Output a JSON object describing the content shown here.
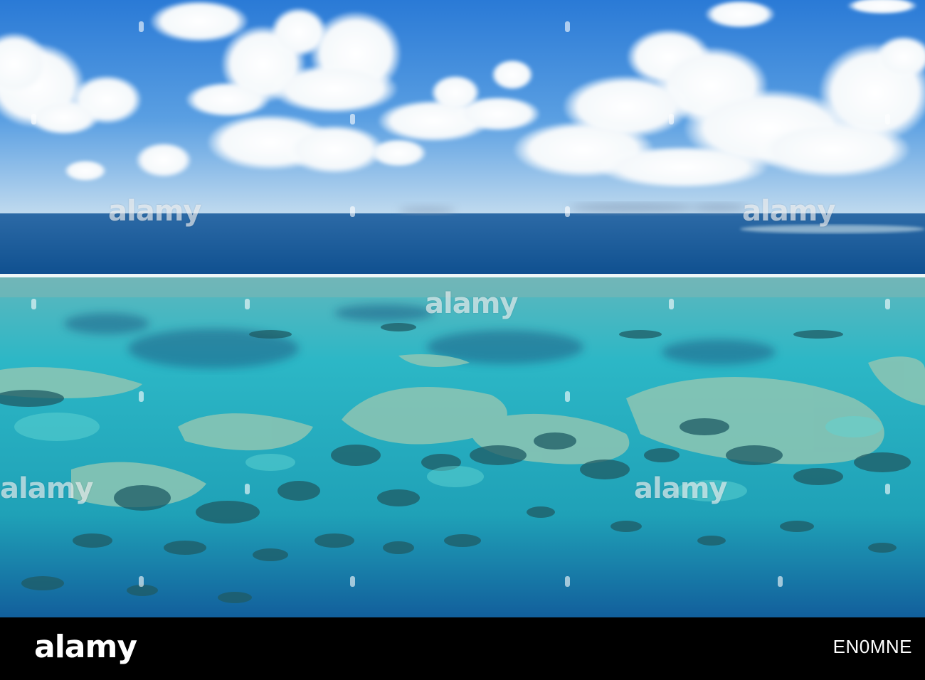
{
  "watermark": {
    "text": "alamy"
  },
  "footer": {
    "logo": "alamy",
    "image_id": "EN0MNE"
  },
  "colors": {
    "sky_top": "#2f7fd9",
    "sky_horizon": "#b8d6ee",
    "ocean_deep": "#0f4f8e",
    "breaker_line": "#e8f4f6",
    "lagoon": "#2bb8c4",
    "reef_dark": "#1e5f66",
    "reef_sand": "#8fc7b6",
    "footer_bg": "#000000"
  }
}
